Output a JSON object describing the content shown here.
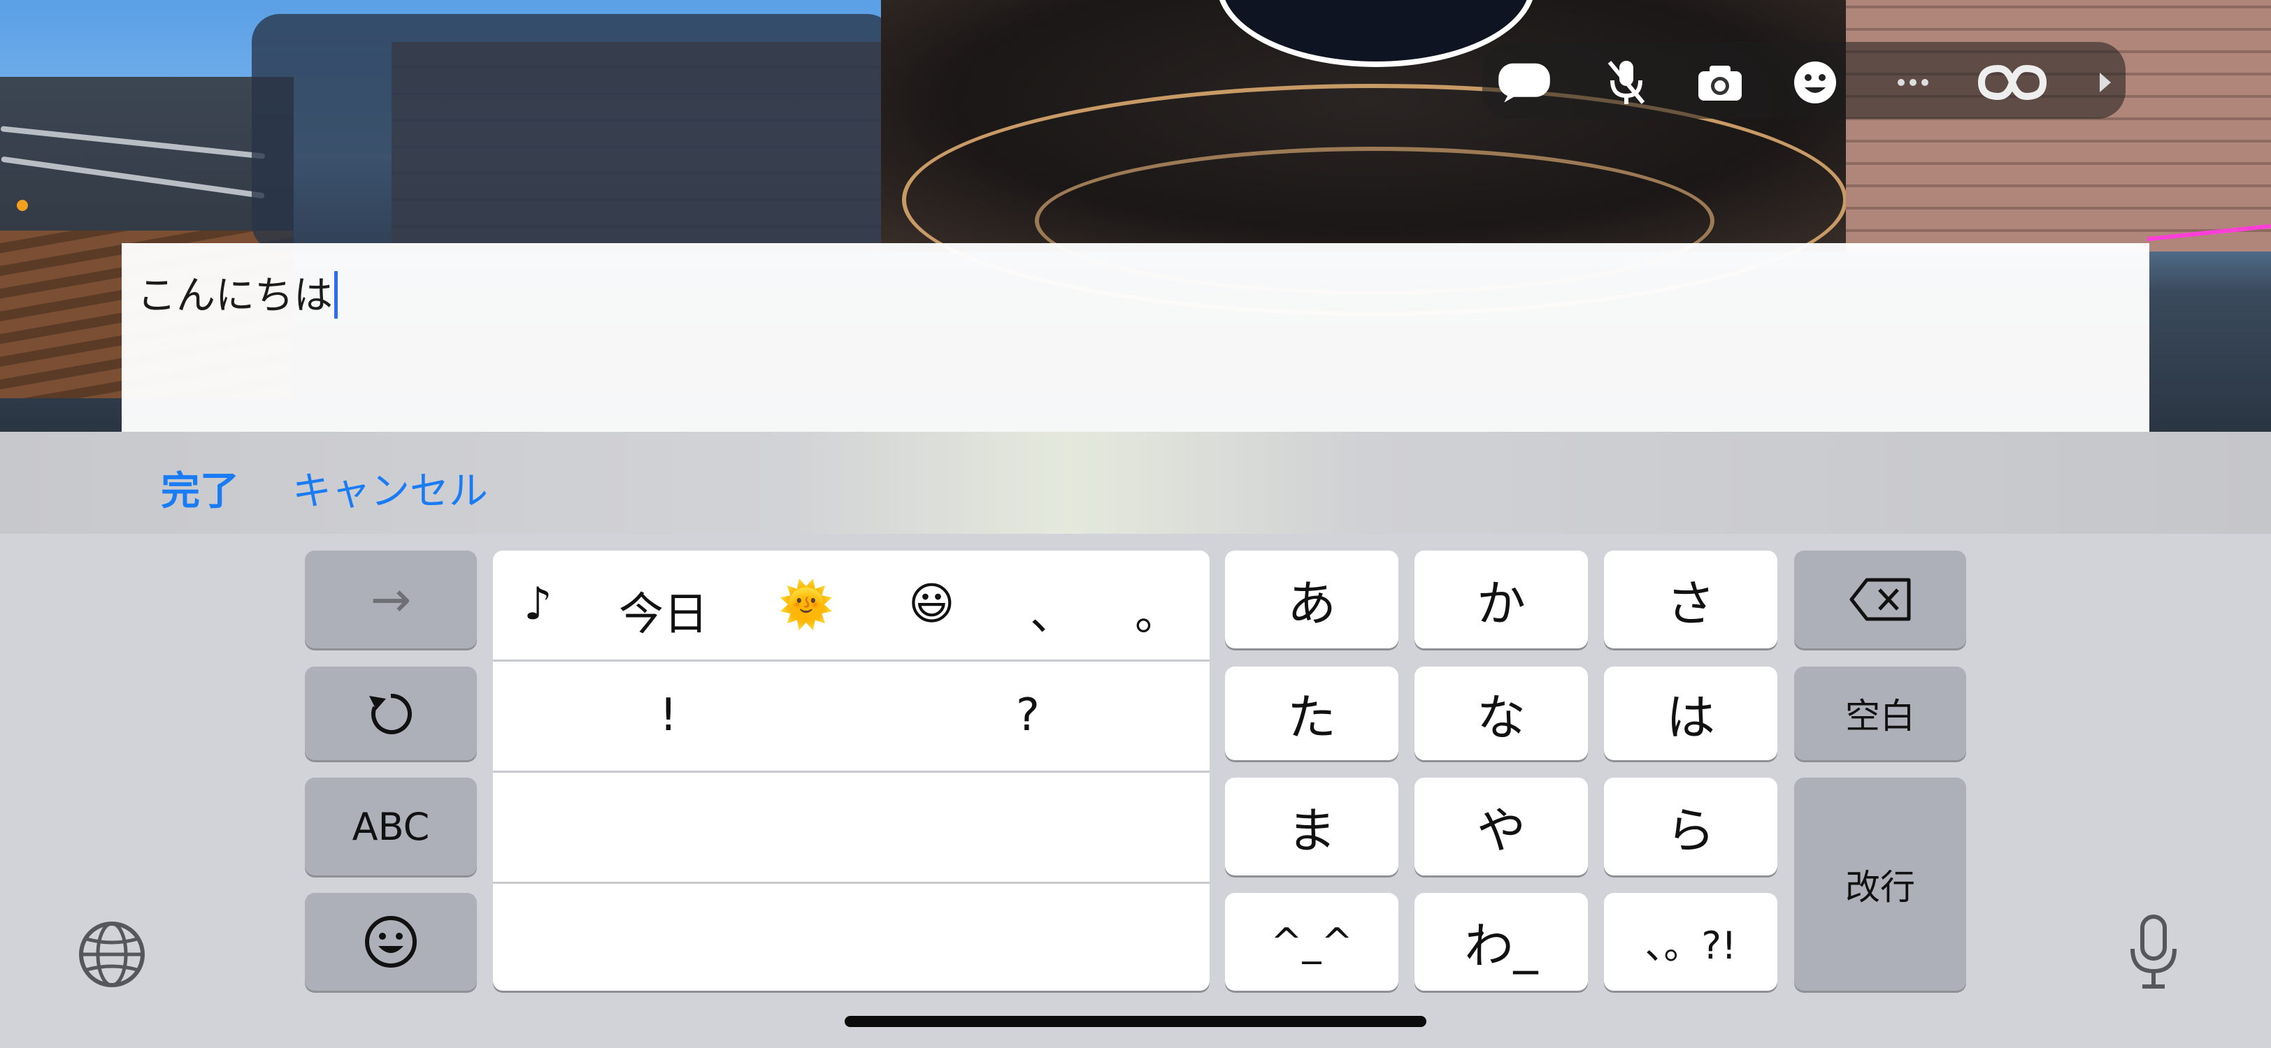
{
  "input": {
    "text": "こんにちは"
  },
  "accessory": {
    "done_label": "完了",
    "cancel_label": "キャンセル"
  },
  "keyboard": {
    "arrow_label": "→",
    "undo_label": "↺",
    "abc_label": "ABC",
    "emoji_label": "☺",
    "kana_keys": [
      "あ",
      "か",
      "さ",
      "た",
      "な",
      "は",
      "ま",
      "や",
      "ら",
      "^_^",
      "わ_",
      "、。?!"
    ],
    "backspace_label": "⌫",
    "space_label": "空白",
    "return_label": "改行"
  },
  "candidates": {
    "row1": [
      "♪",
      "今日",
      "🌞",
      "😃",
      "、",
      "。"
    ],
    "row2": [
      "!",
      "?"
    ]
  },
  "toolbar": {
    "icons": [
      "chat-bubble-icon",
      "mic-muted-icon",
      "camera-icon",
      "emoji-face-icon",
      "more-icon",
      "infinity-icon",
      "arrow-right-icon"
    ]
  },
  "colors": {
    "accent": "#1a7cf5",
    "caret": "#2e6cf6",
    "keyboard_bg": "#d1d3d9"
  }
}
